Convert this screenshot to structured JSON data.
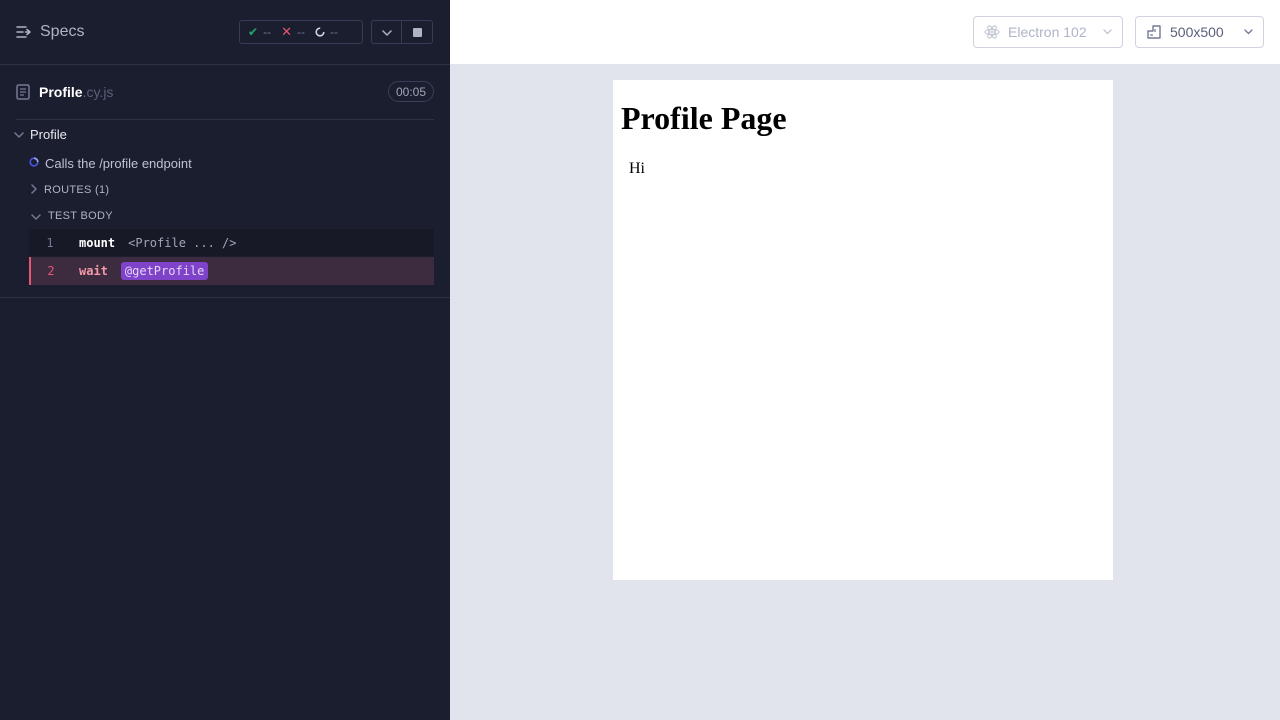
{
  "reporter": {
    "header": {
      "specs_label": "Specs",
      "stats": {
        "passed": "--",
        "failed": "--",
        "pending": "--"
      }
    },
    "file": {
      "name": "Profile",
      "extension": ".cy.js",
      "duration": "00:05"
    },
    "suite": {
      "title": "Profile"
    },
    "test": {
      "title": "Calls the /profile endpoint",
      "routes_label": "ROUTES (1)",
      "body_label": "TEST BODY",
      "commands": [
        {
          "number": "1",
          "name": "mount",
          "message": "<Profile ... />"
        },
        {
          "number": "2",
          "name": "wait",
          "alias": "@getProfile",
          "state": "failed"
        }
      ]
    }
  },
  "aut": {
    "browser": "Electron 102",
    "viewport": "500x500",
    "content": {
      "heading": "Profile Page",
      "text": "Hi"
    }
  },
  "colors": {
    "reporter_bg": "#1b1e2e",
    "aut_bg": "#e1e3ed",
    "pass": "#1fa971",
    "fail": "#e45770",
    "alias_bg": "#7f43c9"
  }
}
